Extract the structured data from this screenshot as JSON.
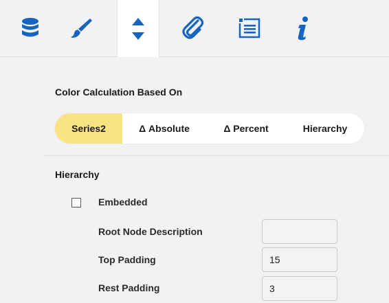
{
  "toolbar": {
    "tabs": [
      {
        "icon": "database-icon",
        "active": false
      },
      {
        "icon": "brush-icon",
        "active": false
      },
      {
        "icon": "sort-arrows-icon",
        "active": true
      },
      {
        "icon": "paperclip-icon",
        "active": false
      },
      {
        "icon": "list-icon",
        "active": false
      },
      {
        "icon": "info-icon",
        "active": false
      }
    ],
    "icon_color": "#1565c0"
  },
  "color_calc": {
    "title": "Color Calculation Based On",
    "options": [
      "Series2",
      "Δ Absolute",
      "Δ Percent",
      "Hierarchy"
    ],
    "selected": "Series2",
    "selected_color": "#f9e483"
  },
  "hierarchy": {
    "title": "Hierarchy",
    "embedded_label": "Embedded",
    "embedded_checked": false,
    "fields": [
      {
        "label": "Root Node Description",
        "value": ""
      },
      {
        "label": "Top Padding",
        "value": "15"
      },
      {
        "label": "Rest Padding",
        "value": "3"
      }
    ]
  }
}
